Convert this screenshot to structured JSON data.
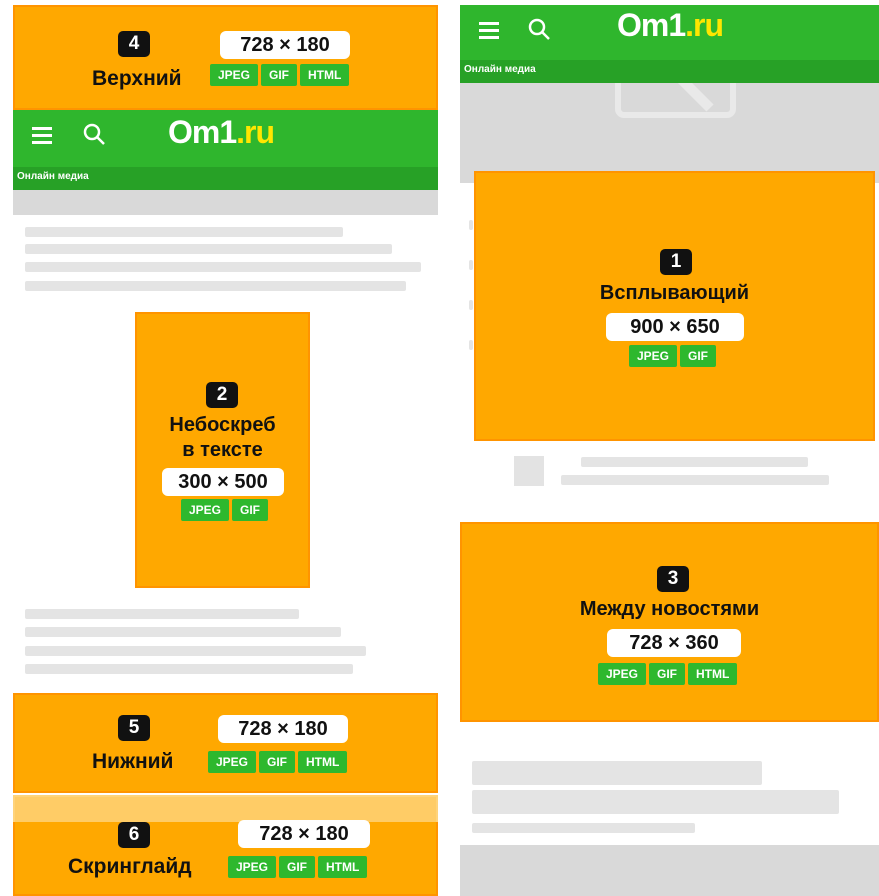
{
  "header": {
    "logo_main": "Om1",
    "logo_domain": ".ru",
    "subtitle": "Онлайн медиа",
    "icons": [
      "menu-icon",
      "search-icon"
    ]
  },
  "ad_slots": [
    {
      "number": "4",
      "title": "Верхний",
      "size": "728 × 180",
      "formats": [
        "JPEG",
        "GIF",
        "HTML"
      ]
    },
    {
      "number": "2",
      "title_line1": "Небоскреб",
      "title_line2": "в тексте",
      "size": "300 × 500",
      "formats": [
        "JPEG",
        "GIF"
      ]
    },
    {
      "number": "5",
      "title": "Нижний",
      "size": "728 × 180",
      "formats": [
        "JPEG",
        "GIF",
        "HTML"
      ]
    },
    {
      "number": "6",
      "title": "Скринглайд",
      "size": "728 × 180",
      "formats": [
        "JPEG",
        "GIF",
        "HTML"
      ]
    },
    {
      "number": "1",
      "title": "Всплывающий",
      "size": "900 × 650",
      "formats": [
        "JPEG",
        "GIF"
      ]
    },
    {
      "number": "3",
      "title": "Между новостями",
      "size": "728 × 360",
      "formats": [
        "JPEG",
        "GIF",
        "HTML"
      ]
    }
  ],
  "colors": {
    "ad_orange": "#ffa800",
    "brand_green": "#2fb62d",
    "format_green": "#2eb82e",
    "logo_yellow": "#ffe600"
  }
}
